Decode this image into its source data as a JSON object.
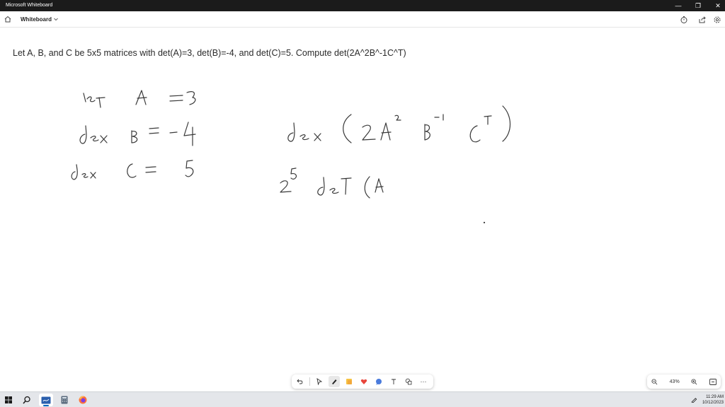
{
  "window": {
    "title": "Microsoft Whiteboard",
    "controls": {
      "minimize": "—",
      "maximize": "❐",
      "close": "✕"
    }
  },
  "header": {
    "board_name": "Whiteboard",
    "icons": [
      "home-icon",
      "chevron-down-icon",
      "timer-icon",
      "share-icon",
      "settings-icon"
    ]
  },
  "canvas": {
    "problem": "Let A, B, and C be 5x5 matrices with det(A)=3, det(B)=-4, and det(C)=5. Compute det(2A^2B^-1C^T)",
    "handwriting_left": [
      "let A =3",
      "det B = -4",
      "det C = 5"
    ],
    "handwriting_right": [
      "det(2A² B⁻¹ Cᵀ)",
      "2⁵ det(A"
    ]
  },
  "toolbar": {
    "tools": [
      "undo-icon",
      "select-icon",
      "pen-icon",
      "sticky-note-icon",
      "reactions-icon",
      "chat-icon",
      "text-icon",
      "shapes-icon",
      "more-icon"
    ],
    "more_label": "···"
  },
  "zoom": {
    "level": "43%"
  },
  "taskbar": {
    "apps": [
      "windows-start-icon",
      "search-icon",
      "mail-icon",
      "calculator-icon",
      "firefox-icon"
    ],
    "time": "11:29 AM",
    "date": "10/12/2023"
  },
  "colors": {
    "titlebar": "#1b1b1b",
    "accent": "#0067c0",
    "ink": "#3a3a3a",
    "reaction_heart": "#e8453c"
  }
}
